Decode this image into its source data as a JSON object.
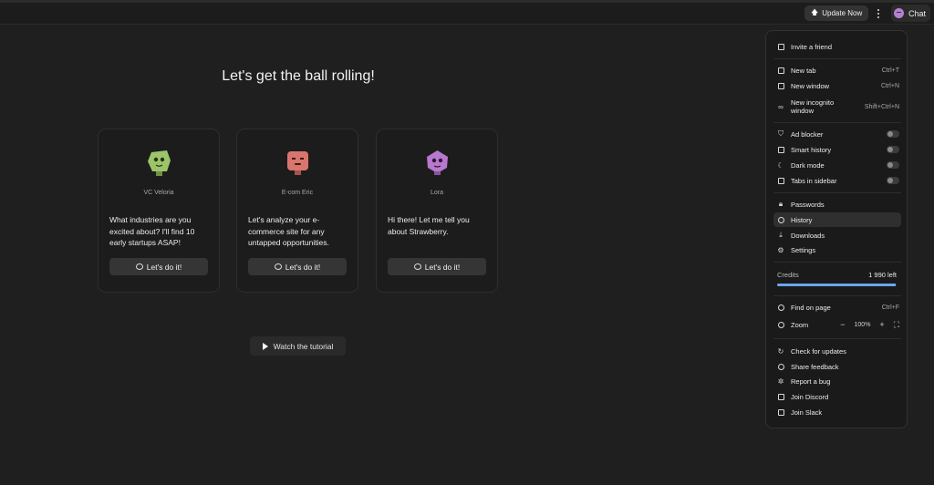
{
  "topbar": {
    "update_label": "Update Now",
    "chat_label": "Chat"
  },
  "main": {
    "title": "Let's get the ball rolling!",
    "cards": [
      {
        "name": "VC Veloria",
        "description": "What industries are you excited about? I'll find 10 early startups ASAP!",
        "cta": "Let's do it!",
        "color": "#9cc46a"
      },
      {
        "name": "E-com Eric",
        "description": "Let's analyze your e-commerce site for any untapped opportunities.",
        "cta": "Let's do it!",
        "color": "#d9756d"
      },
      {
        "name": "Lora",
        "description": "Hi there! Let me tell you about Strawberry.",
        "cta": "Let's do it!",
        "color": "#b878cf"
      }
    ],
    "tutorial_label": "Watch the tutorial"
  },
  "menu": {
    "invite": "Invite a friend",
    "new_tab": "New tab",
    "new_tab_sc": "Ctrl+T",
    "new_window": "New window",
    "new_window_sc": "Ctrl+N",
    "incognito": "New incognito window",
    "incognito_sc": "Shift+Ctrl+N",
    "ad_blocker": "Ad blocker",
    "smart_history": "Smart history",
    "dark_mode": "Dark mode",
    "tabs_sidebar": "Tabs in sidebar",
    "passwords": "Passwords",
    "history": "History",
    "downloads": "Downloads",
    "settings": "Settings",
    "credits_label": "Credits",
    "credits_left": "1 990 left",
    "credits_fraction": 0.995,
    "find": "Find on page",
    "find_sc": "Ctrl+F",
    "zoom": "Zoom",
    "zoom_level": "100%",
    "check_updates": "Check for updates",
    "share_feedback": "Share feedback",
    "report_bug": "Report a bug",
    "join_discord": "Join Discord",
    "join_slack": "Join Slack"
  }
}
